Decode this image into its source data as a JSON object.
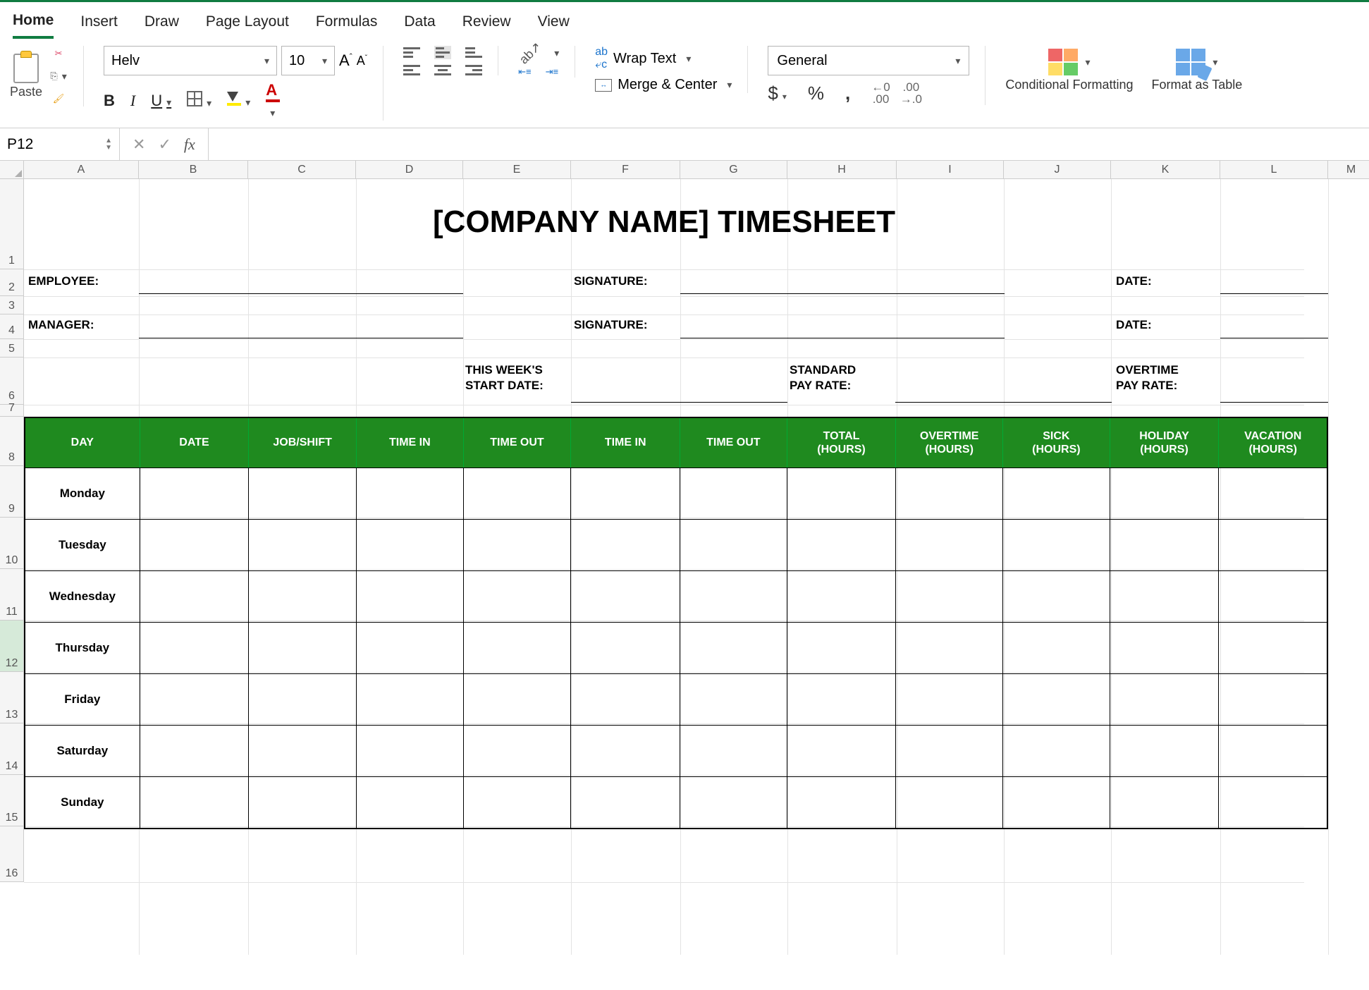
{
  "ribbon": {
    "tabs": [
      "Home",
      "Insert",
      "Draw",
      "Page Layout",
      "Formulas",
      "Data",
      "Review",
      "View"
    ],
    "active_tab": "Home",
    "paste_label": "Paste",
    "font_name": "Helv",
    "font_size": "10",
    "wrap_text": "Wrap Text",
    "merge_center": "Merge & Center",
    "number_format": "General",
    "conditional_formatting": "Conditional Formatting",
    "format_as_table": "Format as Table"
  },
  "formula_bar": {
    "name_box": "P12",
    "fx": "fx",
    "formula": ""
  },
  "columns": {
    "letters": [
      "A",
      "B",
      "C",
      "D",
      "E",
      "F",
      "G",
      "H",
      "I",
      "J",
      "K",
      "L",
      "M"
    ],
    "widths": [
      163,
      155,
      153,
      152,
      153,
      155,
      152,
      155,
      152,
      152,
      155,
      153,
      66
    ]
  },
  "rows": {
    "numbers": [
      "1",
      "2",
      "3",
      "4",
      "5",
      "6",
      "7",
      "8",
      "9",
      "10",
      "11",
      "12",
      "13",
      "14",
      "15",
      "16"
    ],
    "heights": [
      128,
      38,
      26,
      35,
      26,
      67,
      17,
      70,
      73,
      73,
      73,
      73,
      73,
      73,
      73,
      79
    ]
  },
  "timesheet": {
    "title": "[COMPANY NAME] TIMESHEET",
    "labels": {
      "employee": "EMPLOYEE:",
      "signature": "SIGNATURE:",
      "date": "DATE:",
      "manager": "MANAGER:",
      "week_start_a": "THIS WEEK'S",
      "week_start_b": "START DATE:",
      "std_rate_a": "STANDARD",
      "std_rate_b": "PAY RATE:",
      "ot_rate_a": "OVERTIME",
      "ot_rate_b": "PAY RATE:"
    },
    "headers": [
      "DAY",
      "DATE",
      "JOB/SHIFT",
      "TIME IN",
      "TIME OUT",
      "TIME IN",
      "TIME OUT",
      "TOTAL (HOURS)",
      "OVERTIME (HOURS)",
      "SICK (HOURS)",
      "HOLIDAY (HOURS)",
      "VACATION (HOURS)"
    ],
    "days": [
      "Monday",
      "Tuesday",
      "Wednesday",
      "Thursday",
      "Friday",
      "Saturday",
      "Sunday"
    ]
  },
  "active_cell": "P12"
}
